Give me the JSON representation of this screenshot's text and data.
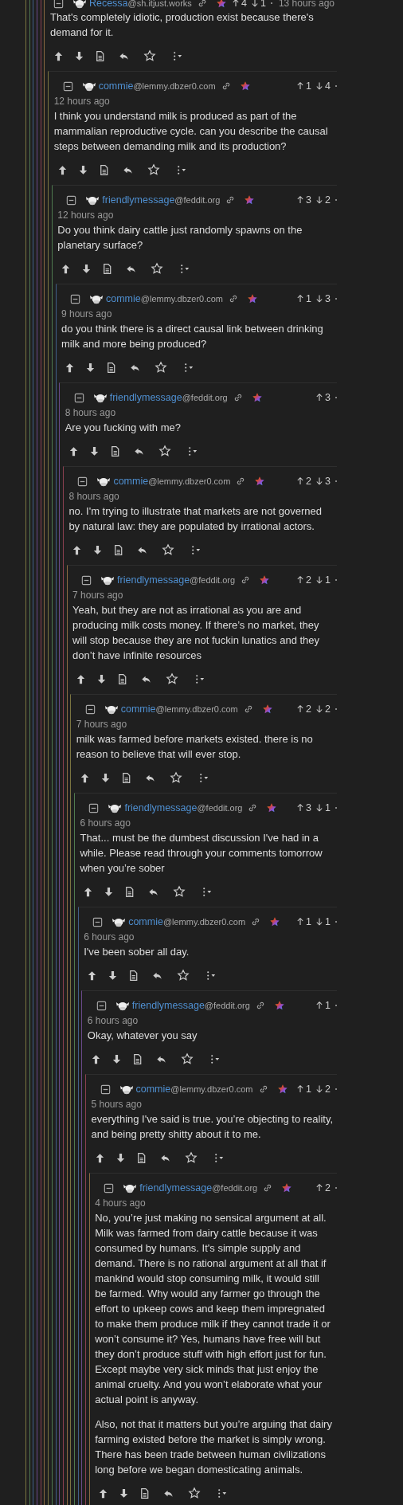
{
  "thread": {
    "user": "Recessa",
    "instance": "@sh.itjust.works",
    "up": "4",
    "down": "1",
    "time": "13 hours ago",
    "body": [
      "That's completely idiotic, production exist because there's demand for it."
    ],
    "children": [
      {
        "user": "commie",
        "instance": "@lemmy.dbzer0.com",
        "up": "1",
        "down": "4",
        "time": "12 hours ago",
        "body": [
          "I think you understand milk is produced as part of the mammalian reproductive cycle. can you describe the causal steps between demanding milk and its production?"
        ],
        "children": [
          {
            "user": "friendlymessage",
            "instance": "@feddit.org",
            "up": "3",
            "down": "2",
            "time": "12 hours ago",
            "body": [
              "Do you think dairy cattle just randomly spawns on the planetary surface?"
            ],
            "children": [
              {
                "user": "commie",
                "instance": "@lemmy.dbzer0.com",
                "up": "1",
                "down": "3",
                "time": "9 hours ago",
                "body": [
                  "do you think there is a direct causal link between drinking milk and more being produced?"
                ],
                "children": [
                  {
                    "user": "friendlymessage",
                    "instance": "@feddit.org",
                    "up": "3",
                    "time": "8 hours ago",
                    "body": [
                      "Are you fucking with me?"
                    ],
                    "children": [
                      {
                        "user": "commie",
                        "instance": "@lemmy.dbzer0.com",
                        "up": "2",
                        "down": "3",
                        "time": "8 hours ago",
                        "body": [
                          "no. I'm trying to illustrate that markets are not governed by natural law: they are populated by irrational actors."
                        ],
                        "children": [
                          {
                            "user": "friendlymessage",
                            "instance": "@feddit.org",
                            "up": "2",
                            "down": "1",
                            "time": "7 hours ago",
                            "body": [
                              "Yeah, but they are not as irrational as you are and producing milk costs money. If there’s no market, they will stop because they are not fuckin lunatics and they don’t have infinite resources"
                            ],
                            "children": [
                              {
                                "user": "commie",
                                "instance": "@lemmy.dbzer0.com",
                                "up": "2",
                                "down": "2",
                                "time": "7 hours ago",
                                "body": [
                                  "milk was farmed before markets existed. there is no reason to believe that will ever stop."
                                ],
                                "children": [
                                  {
                                    "user": "friendlymessage",
                                    "instance": "@feddit.org",
                                    "up": "3",
                                    "down": "1",
                                    "time": "6 hours ago",
                                    "body": [
                                      "That... must be the dumbest discussion I've had in a while. Please read through your comments tomorrow when you’re sober"
                                    ],
                                    "children": [
                                      {
                                        "user": "commie",
                                        "instance": "@lemmy.dbzer0.com",
                                        "up": "1",
                                        "down": "1",
                                        "time": "6 hours ago",
                                        "body": [
                                          "I've been sober all day."
                                        ],
                                        "children": [
                                          {
                                            "user": "friendlymessage",
                                            "instance": "@feddit.org",
                                            "up": "1",
                                            "time": "6 hours ago",
                                            "body": [
                                              "Okay, whatever you say"
                                            ],
                                            "children": [
                                              {
                                                "user": "commie",
                                                "instance": "@lemmy.dbzer0.com",
                                                "up": "1",
                                                "down": "2",
                                                "time": "5 hours ago",
                                                "body": [
                                                  "everything I've said is true. you’re objecting to reality, and being pretty shitty about it to me."
                                                ],
                                                "children": [
                                                  {
                                                    "user": "friendlymessage",
                                                    "instance": "@feddit.org",
                                                    "up": "2",
                                                    "time": "4 hours ago",
                                                    "body": [
                                                      "No, you’re just making no sensical argument at all. Milk was farmed from dairy cattle because it was consumed by humans. It's simple supply and demand. There is no rational argument at all that if mankind would stop consuming milk, it would still be farmed. Why would any farmer go through the effort to upkeep cows and keep them impregnated to make them produce milk if they cannot trade it or won’t consume it? Yes, humans have free will but they don’t produce stuff with high effort just for fun. Except maybe very sick minds that just enjoy the animal cruelty. And you won’t elaborate what your actual point is anyway.",
                                                      "Also, not that it matters but you’re arguing that dairy farming existed before the market is simply wrong. There has been trade between human civilizations long before we began domesticating animals."
                                                    ]
                                                  }
                                                ]
                                              }
                                            ]
                                          }
                                        ]
                                      }
                                    ]
                                  }
                                ]
                              }
                            ]
                          }
                        ]
                      }
                    ]
                  }
                ]
              }
            ]
          }
        ]
      }
    ]
  }
}
